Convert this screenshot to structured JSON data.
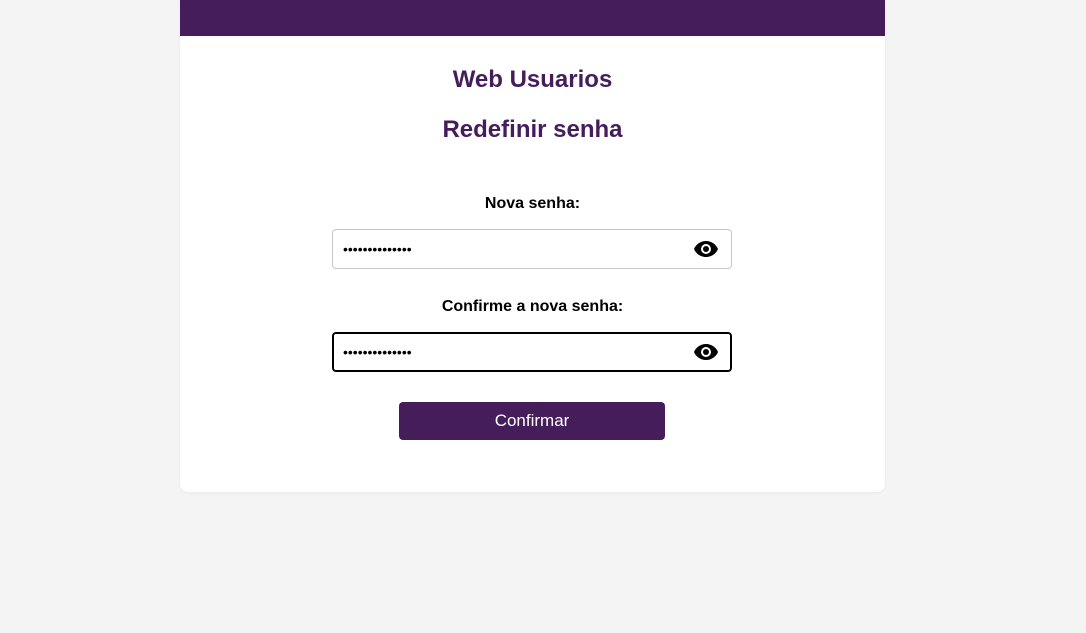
{
  "app": {
    "title": "Web Usuarios",
    "subtitle": "Redefinir senha",
    "brand_color": "#451d5b"
  },
  "form": {
    "new_password": {
      "label": "Nova senha:",
      "value": "••••••••••••••",
      "toggle_icon": "eye-icon"
    },
    "confirm_password": {
      "label": "Confirme a nova senha:",
      "value": "••••••••••••••",
      "toggle_icon": "eye-icon",
      "focused": true
    },
    "submit_label": "Confirmar"
  }
}
